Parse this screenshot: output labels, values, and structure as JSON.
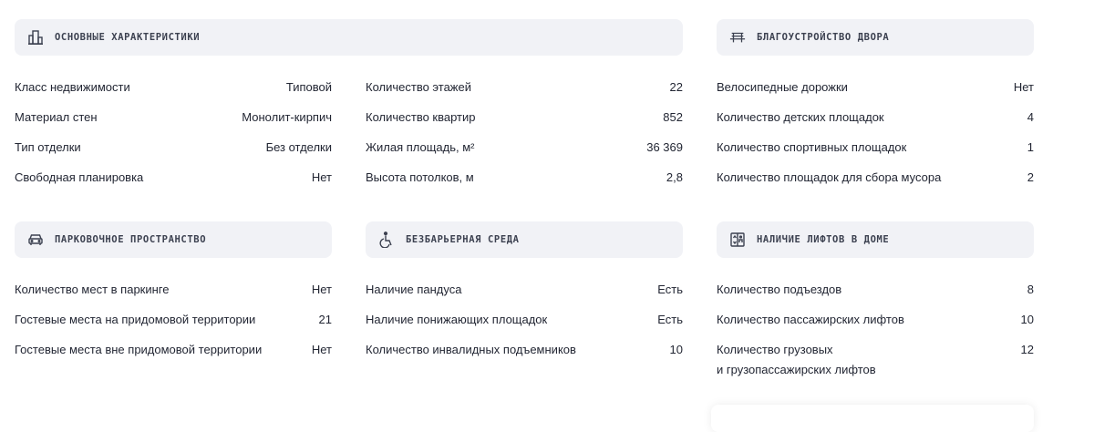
{
  "sections": {
    "main": {
      "title": "ОСНОВНЫЕ ХАРАКТЕРИСТИКИ",
      "col1": [
        {
          "label": "Класс недвижимости",
          "value": "Типовой"
        },
        {
          "label": "Материал стен",
          "value": "Монолит-кирпич"
        },
        {
          "label": "Тип отделки",
          "value": "Без отделки"
        },
        {
          "label": "Свободная планировка",
          "value": "Нет"
        }
      ],
      "col2": [
        {
          "label": "Количество этажей",
          "value": "22"
        },
        {
          "label": "Количество квартир",
          "value": "852"
        },
        {
          "label": "Жилая площадь, м²",
          "value": "36 369"
        },
        {
          "label": "Высота потолков, м",
          "value": "2,8"
        }
      ]
    },
    "yard": {
      "title": "БЛАГОУСТРОЙСТВО ДВОРА",
      "rows": [
        {
          "label": "Велосипедные дорожки",
          "value": "Нет"
        },
        {
          "label": "Количество детских площадок",
          "value": "4"
        },
        {
          "label": "Количество спортивных площадок",
          "value": "1"
        },
        {
          "label": "Количество площадок для сбора мусора",
          "value": "2"
        }
      ]
    },
    "parking": {
      "title": "ПАРКОВОЧНОЕ ПРОСТРАНСТВО",
      "rows": [
        {
          "label": "Количество мест в паркинге",
          "value": "Нет"
        },
        {
          "label": "Гостевые места на придомовой территории",
          "value": "21"
        },
        {
          "label": "Гостевые места вне придомовой территории",
          "value": "Нет"
        }
      ]
    },
    "barrier_free": {
      "title": "БЕЗБАРЬЕРНАЯ СРЕДА",
      "rows": [
        {
          "label": "Наличие пандуса",
          "value": "Есть"
        },
        {
          "label": "Наличие понижающих площадок",
          "value": "Есть"
        },
        {
          "label": "Количество инвалидных подъемников",
          "value": "10"
        }
      ]
    },
    "elevators": {
      "title": "НАЛИЧИЕ ЛИФТОВ В ДОМЕ",
      "rows": [
        {
          "label": "Количество подъездов",
          "value": "8"
        },
        {
          "label": "Количество пассажирских лифтов",
          "value": "10"
        },
        {
          "label_line1": "Количество грузовых",
          "label_line2": "и грузопассажирских лифтов",
          "value": "12"
        }
      ]
    }
  },
  "icons": {
    "main": "building-icon",
    "yard": "bench-icon",
    "parking": "car-icon",
    "barrier_free": "wheelchair-icon",
    "elevators": "elevator-icon"
  }
}
